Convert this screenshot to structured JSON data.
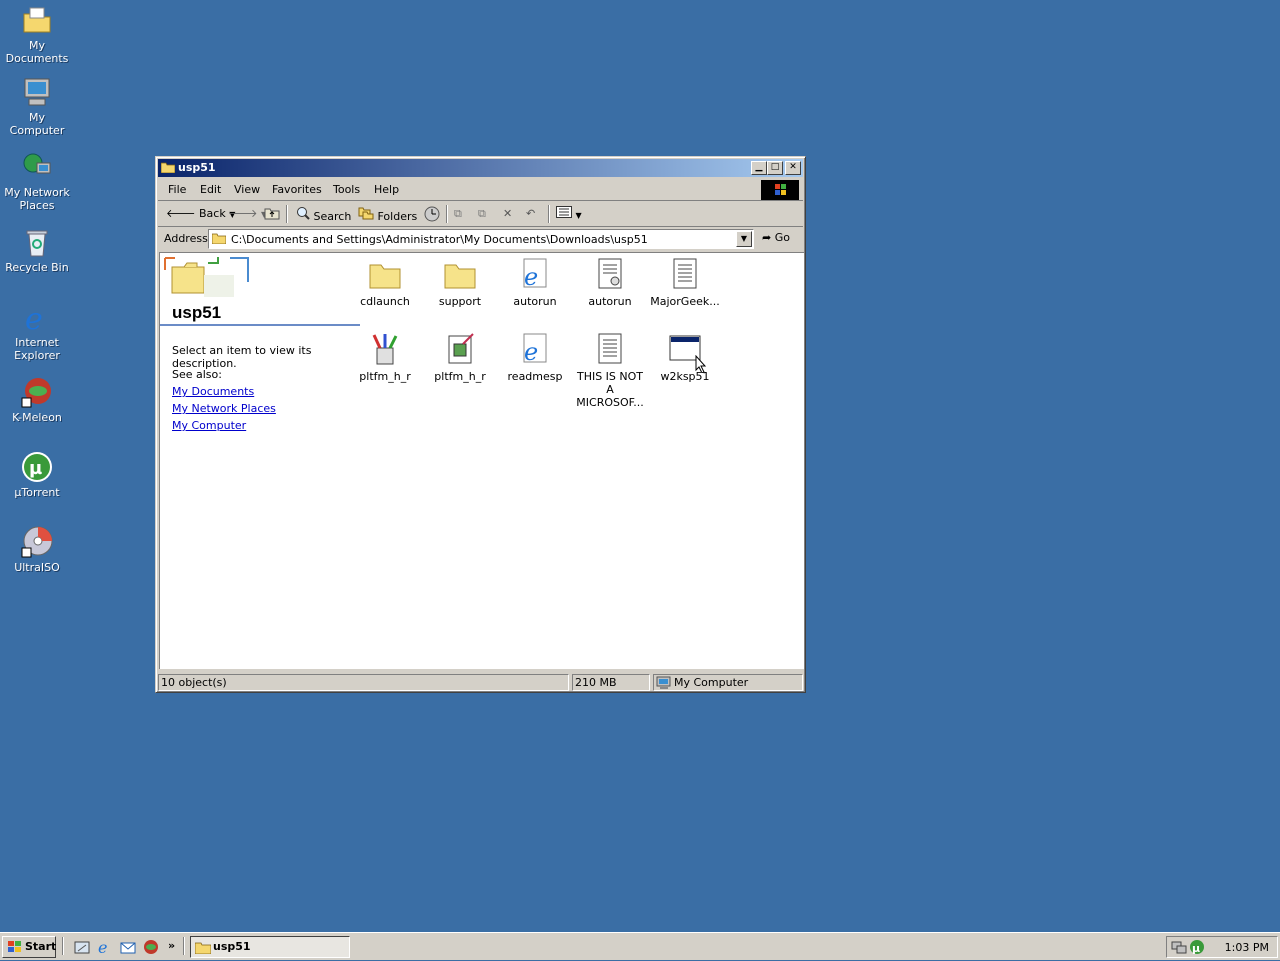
{
  "desktop": {
    "icons": [
      {
        "label": "My Documents",
        "icon": "my-documents-icon"
      },
      {
        "label": "My Computer",
        "icon": "my-computer-icon"
      },
      {
        "label": "My Network Places",
        "icon": "network-places-icon"
      },
      {
        "label": "Recycle Bin",
        "icon": "recycle-bin-icon"
      },
      {
        "label": "Internet Explorer",
        "icon": "internet-explorer-icon"
      },
      {
        "label": "K-Meleon",
        "icon": "k-meleon-icon"
      },
      {
        "label": "µTorrent",
        "icon": "utorrent-icon"
      },
      {
        "label": "UltraISO",
        "icon": "ultraiso-icon"
      }
    ]
  },
  "window": {
    "title": "usp51",
    "menu": [
      "File",
      "Edit",
      "View",
      "Favorites",
      "Tools",
      "Help"
    ],
    "toolbar": {
      "back": "Back",
      "search": "Search",
      "folders": "Folders"
    },
    "address": {
      "label": "Address",
      "value": "C:\\Documents and Settings\\Administrator\\My Documents\\Downloads\\usp51",
      "go": "Go"
    },
    "left_pane": {
      "folder_name": "usp51",
      "description": "Select an item to view its description.",
      "see_also": "See also:",
      "links": [
        "My Documents",
        "My Network Places",
        "My Computer"
      ]
    },
    "files": [
      {
        "name": "cdlaunch",
        "type": "folder"
      },
      {
        "name": "support",
        "type": "folder"
      },
      {
        "name": "autorun",
        "type": "html"
      },
      {
        "name": "autorun",
        "type": "inf"
      },
      {
        "name": "MajorGeek...",
        "type": "text"
      },
      {
        "name": "pltfm_h_r",
        "type": "tools"
      },
      {
        "name": "pltfm_h_r",
        "type": "installer"
      },
      {
        "name": "readmesp",
        "type": "html"
      },
      {
        "name": "THIS IS NOT A MICROSOF...",
        "type": "text"
      },
      {
        "name": "w2ksp51",
        "type": "exe"
      }
    ],
    "status": {
      "objects": "10 object(s)",
      "size": "210 MB",
      "zone": "My Computer"
    }
  },
  "taskbar": {
    "start": "Start",
    "task": "usp51",
    "clock": "1:03 PM"
  },
  "colors": {
    "desktop": "#3a6ea5",
    "title_start": "#0a246a",
    "title_end": "#a6caf0",
    "face": "#d4d0c8",
    "link": "#0000cc"
  }
}
